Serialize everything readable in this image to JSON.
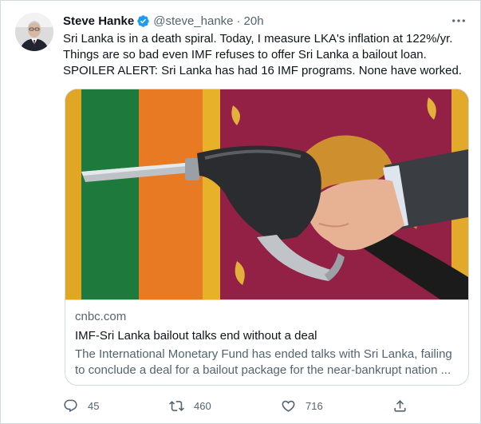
{
  "author": {
    "name": "Steve Hanke",
    "handle": "@steve_hanke",
    "separator": "·",
    "time": "20h"
  },
  "tweet": {
    "lines": [
      "Sri Lanka is in a death spiral. Today, I measure LKA's inflation at 122%/yr.",
      "Things are so bad even IMF refuses to offer Sri Lanka a bailout loan.",
      "SPOILER ALERT: Sri Lanka has had 16 IMF programs. None have worked."
    ]
  },
  "card": {
    "domain": "cnbc.com",
    "title": "IMF-Sri Lanka bailout talks end without a deal",
    "description_lines": [
      "The International Monetary Fund has ended talks with Sri Lanka, failing",
      "to conclude a deal for a bailout package for the near-bankrupt nation ..."
    ]
  },
  "actions": {
    "replies": "45",
    "retweets": "460",
    "likes": "716"
  },
  "icons": {
    "verified": "verified-badge-icon",
    "more": "more-icon",
    "reply": "reply-icon",
    "retweet": "retweet-icon",
    "like": "heart-icon",
    "share": "share-icon"
  },
  "colors": {
    "verified": "#1d9bf0",
    "text": "#0f1419",
    "secondary": "#536471",
    "border": "#cfd9de"
  }
}
